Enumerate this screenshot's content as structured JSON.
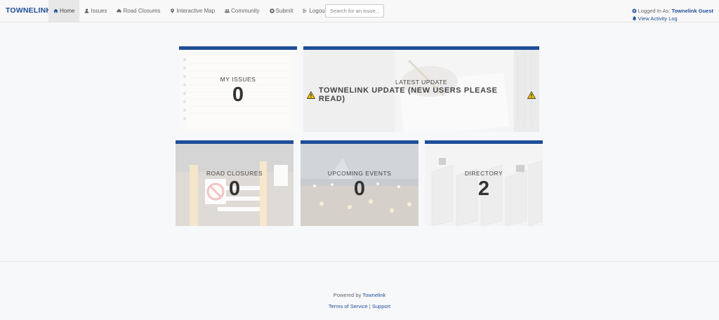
{
  "brand": "TOWNELINK",
  "nav": [
    {
      "label": "Home",
      "icon": "home-icon",
      "active": true
    },
    {
      "label": "Issues",
      "icon": "user-icon"
    },
    {
      "label": "Road Closures",
      "icon": "car-icon"
    },
    {
      "label": "Interactive Map",
      "icon": "map-marker-icon"
    },
    {
      "label": "Community",
      "icon": "users-icon"
    },
    {
      "label": "Submit",
      "icon": "plus-circle-icon"
    },
    {
      "label": "Logout",
      "icon": "sign-out-icon"
    }
  ],
  "search": {
    "placeholder": "Search for an issue..."
  },
  "user": {
    "logged_in_prefix": "Logged In As:",
    "name": "Townelink Guest",
    "activity_log": "View Activity Log"
  },
  "cards": {
    "my_issues": {
      "label": "MY ISSUES",
      "value": "0"
    },
    "latest_update": {
      "label": "LATEST UPDATE",
      "headline": "TOWNELINK UPDATE (NEW USERS PLEASE READ)"
    },
    "road_closures": {
      "label": "ROAD CLOSURES",
      "value": "0"
    },
    "upcoming_events": {
      "label": "UPCOMING EVENTS",
      "value": "0"
    },
    "directory": {
      "label": "DIRECTORY",
      "value": "2"
    }
  },
  "footer": {
    "powered_prefix": "Powered by ",
    "powered_link": "Townelink",
    "terms": "Terms of Service",
    "separator": " | ",
    "support": "Support"
  },
  "colors": {
    "accent": "#1f4e99",
    "warning": "#f2c200"
  }
}
